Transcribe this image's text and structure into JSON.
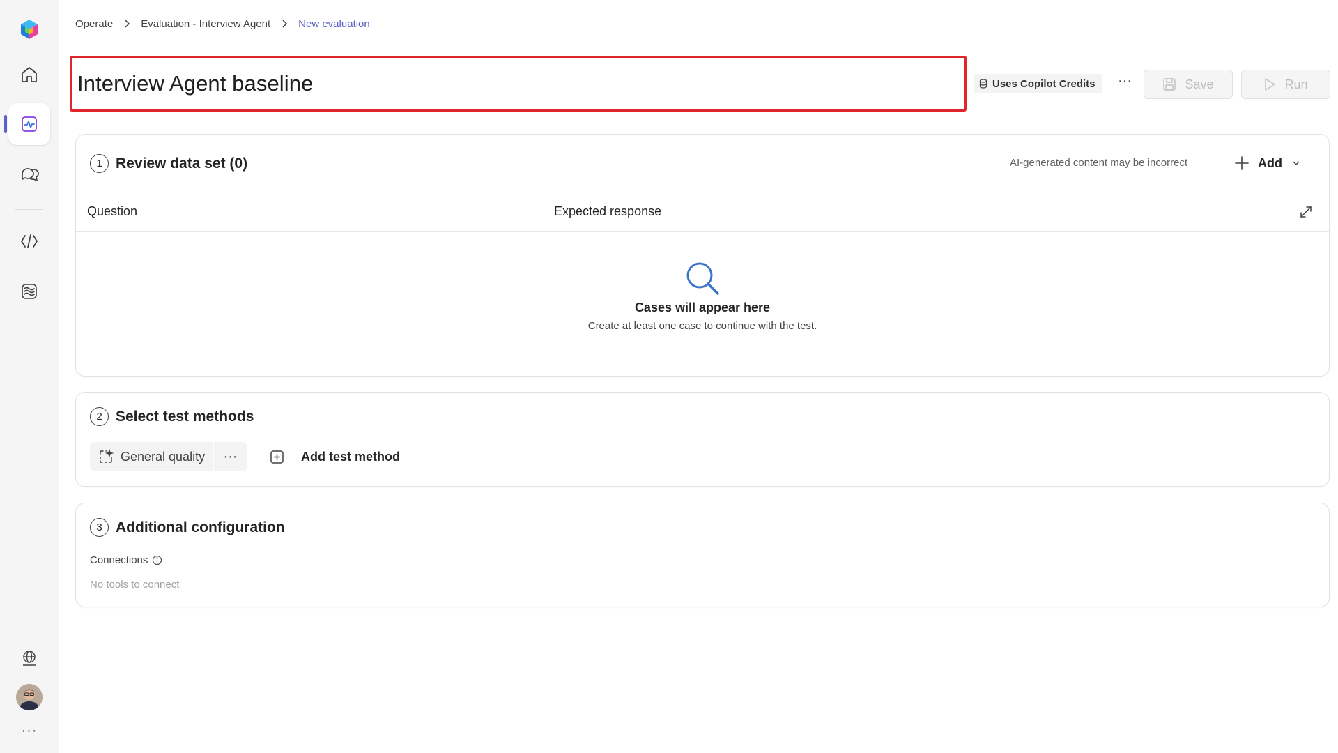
{
  "breadcrumb": {
    "items": [
      "Operate",
      "Evaluation - Interview Agent",
      "New evaluation"
    ]
  },
  "header": {
    "title": "Interview Agent baseline",
    "credits_label": "Uses Copilot Credits",
    "save_label": "Save",
    "run_label": "Run"
  },
  "sidebar": {
    "icons": [
      "app-logo-icon",
      "home-icon",
      "evaluation-icon",
      "chat-icon",
      "code-icon",
      "knowledge-icon",
      "globe-icon"
    ]
  },
  "review": {
    "step": "1",
    "title": "Review data set (0)",
    "ai_note": "AI-generated content may be incorrect",
    "add_label": "Add",
    "columns": [
      "Question",
      "Expected response"
    ],
    "empty_title": "Cases will appear here",
    "empty_subtitle": "Create at least one case to continue with the test."
  },
  "methods": {
    "step": "2",
    "title": "Select test methods",
    "chip_label": "General quality",
    "add_label": "Add test method"
  },
  "config": {
    "step": "3",
    "title": "Additional configuration",
    "connections_label": "Connections",
    "connections_empty": "No tools to connect"
  },
  "colors": {
    "accent": "#5b5fc7",
    "highlight": "#e0252b"
  }
}
